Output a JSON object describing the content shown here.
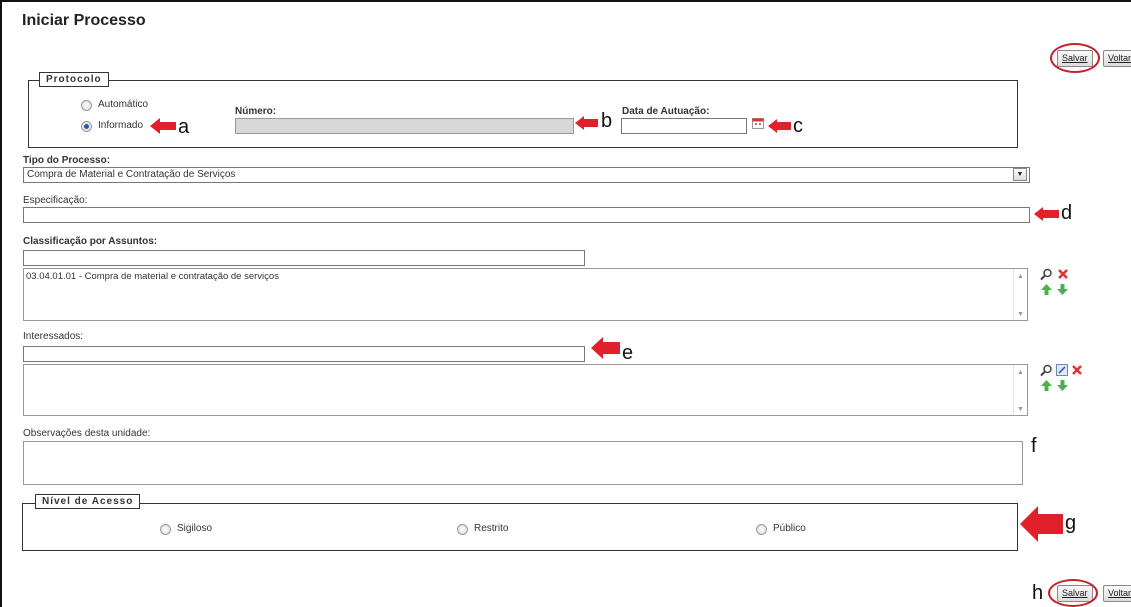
{
  "page": {
    "title": "Iniciar Processo"
  },
  "buttons": {
    "save": "Salvar",
    "back": "Voltar"
  },
  "protocolo": {
    "legend": "Protocolo",
    "options": [
      "Automático",
      "Informado"
    ],
    "selected": "Informado",
    "numero_label": "Número:",
    "numero_value": "",
    "data_label": "Data de Autuação:",
    "data_value": ""
  },
  "tipo": {
    "label": "Tipo do Processo:",
    "value": "Compra de Material e Contratação de Serviços"
  },
  "especificacao": {
    "label": "Especificação:",
    "value": ""
  },
  "classificacao": {
    "label": "Classificação por Assuntos:",
    "search_value": "",
    "items": [
      "03.04.01.01 - Compra de material e contratação de serviços"
    ]
  },
  "interessados": {
    "label": "Interessados:",
    "value": "",
    "items": []
  },
  "observacoes": {
    "label": "Observações desta unidade:",
    "value": ""
  },
  "nivel": {
    "legend": "Nível de Acesso",
    "options": [
      "Sigiloso",
      "Restrito",
      "Público"
    ],
    "selected": ""
  },
  "annotations": [
    "a",
    "b",
    "c",
    "d",
    "e",
    "f",
    "g",
    "h"
  ],
  "colors": {
    "annotation_red": "#e0202a",
    "circle_red": "#c8202a"
  }
}
